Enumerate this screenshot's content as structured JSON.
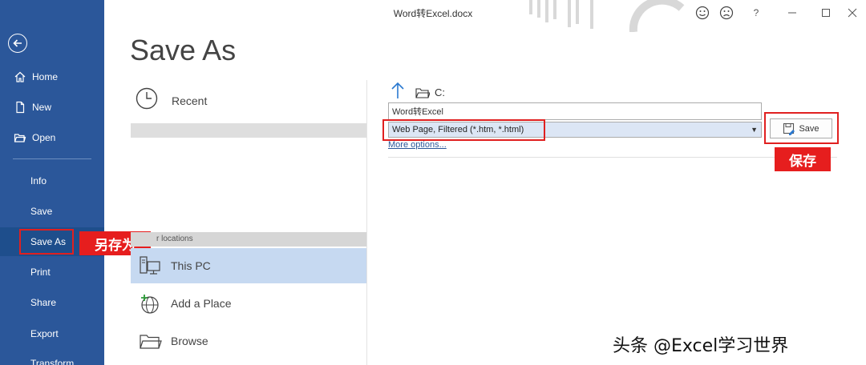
{
  "window": {
    "title": "Word转Excel.docx"
  },
  "sidebar": {
    "items": [
      {
        "label": "Home"
      },
      {
        "label": "New"
      },
      {
        "label": "Open"
      },
      {
        "label": "Info"
      },
      {
        "label": "Save"
      },
      {
        "label": "Save As"
      },
      {
        "label": "Print"
      },
      {
        "label": "Share"
      },
      {
        "label": "Export"
      },
      {
        "label": "Transform"
      }
    ]
  },
  "main": {
    "heading": "Save As",
    "recent_label": "Recent",
    "other_locations": "r locations",
    "locations": [
      {
        "label": "This PC"
      },
      {
        "label": "Add a Place"
      },
      {
        "label": "Browse"
      }
    ]
  },
  "save_panel": {
    "path": "C:",
    "filename": "Word转Excel",
    "filetype": "Web Page, Filtered (*.htm, *.html)",
    "more_options": "More options...",
    "save_label": "Save"
  },
  "annotations": {
    "save_as_cn": "另存为",
    "save_cn": "保存",
    "watermark": "头条 @Excel学习世界"
  },
  "colors": {
    "sidebar_bg": "#2b579a",
    "selected_location": "#c6d9f1",
    "annotation_red": "#e61e1e"
  }
}
